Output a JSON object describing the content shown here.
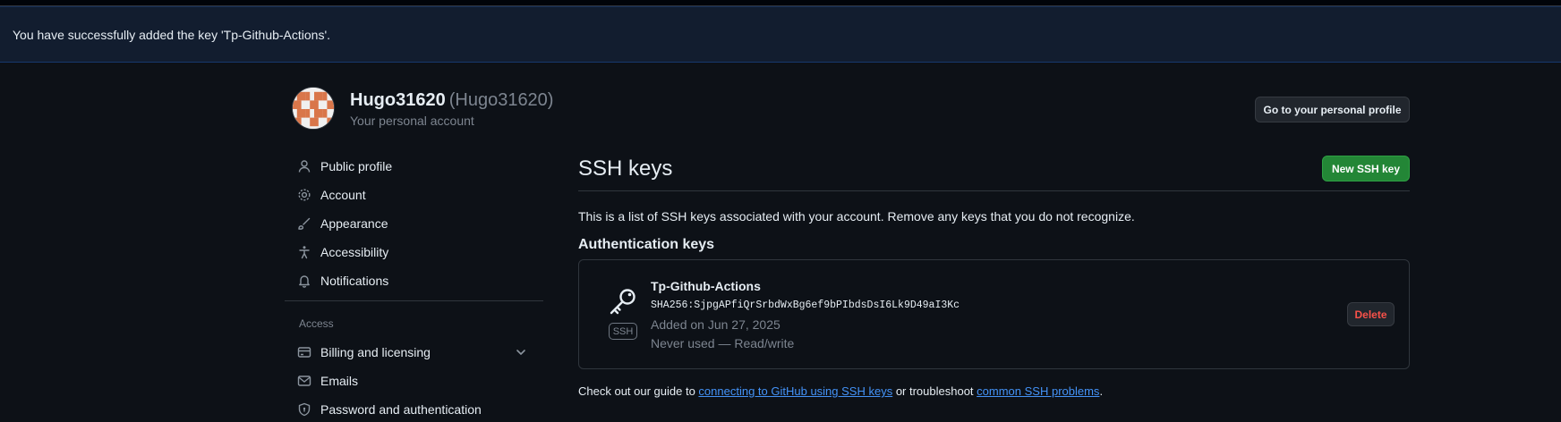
{
  "flash": {
    "message": "You have successfully added the key 'Tp-Github-Actions'."
  },
  "header": {
    "username": "Hugo31620",
    "handle": "(Hugo31620)",
    "subtitle": "Your personal account",
    "profile_button": "Go to your personal profile"
  },
  "sidebar": {
    "items": [
      {
        "label": "Public profile",
        "icon": "person-icon"
      },
      {
        "label": "Account",
        "icon": "gear-icon"
      },
      {
        "label": "Appearance",
        "icon": "paintbrush-icon"
      },
      {
        "label": "Accessibility",
        "icon": "accessibility-icon"
      },
      {
        "label": "Notifications",
        "icon": "bell-icon"
      }
    ],
    "access_heading": "Access",
    "access_items": [
      {
        "label": "Billing and licensing",
        "icon": "credit-card-icon"
      },
      {
        "label": "Emails",
        "icon": "mail-icon"
      },
      {
        "label": "Password and authentication",
        "icon": "shield-lock-icon"
      }
    ]
  },
  "main": {
    "title": "SSH keys",
    "new_button": "New SSH key",
    "description": "This is a list of SSH keys associated with your account. Remove any keys that you do not recognize.",
    "auth_heading": "Authentication keys",
    "key": {
      "title": "Tp-Github-Actions",
      "fingerprint": "SHA256:SjpgAPfiQrSrbdWxBg6ef9bPIbdsDsI6Lk9D49aI3Kc",
      "added": "Added on Jun 27, 2025",
      "usage": "Never used — Read/write",
      "badge": "SSH",
      "delete_label": "Delete"
    },
    "footer": {
      "prefix": "Check out our guide to ",
      "link1": "connecting to GitHub using SSH keys",
      "middle": " or troubleshoot ",
      "link2": "common SSH problems",
      "suffix": "."
    }
  },
  "colors": {
    "background": "#0d1117",
    "flash_bg": "#121d2f",
    "link": "#4493f8",
    "primary_button": "#238636",
    "danger": "#f85149",
    "muted": "#7d8590"
  }
}
